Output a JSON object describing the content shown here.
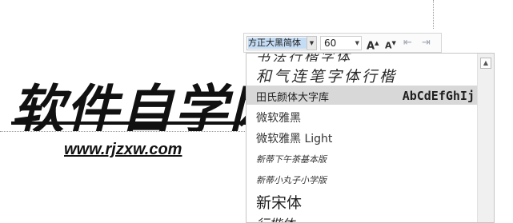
{
  "document": {
    "logo_text": "软件自学网",
    "url_text": "www.rjzxw.com"
  },
  "toolbar": {
    "font_name": "方正大黑简体",
    "font_size": "60",
    "grow_font_label": "A",
    "shrink_font_label": "A"
  },
  "font_list": {
    "items": [
      {
        "name": "书法行楷字体"
      },
      {
        "name": "和气连笔字体行楷"
      },
      {
        "name": "田氏颜体大字库",
        "sample": "AbCdEfGhIj",
        "selected": true
      },
      {
        "name": "微软雅黑"
      },
      {
        "name": "微软雅黑 Light"
      },
      {
        "name": "新蒂下午茶基本版"
      },
      {
        "name": "新蒂小丸子小学版"
      },
      {
        "name": "新宋体"
      },
      {
        "name": "行楷体"
      }
    ]
  }
}
